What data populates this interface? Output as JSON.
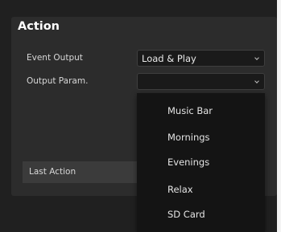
{
  "section": {
    "title": "Action"
  },
  "fields": {
    "event_output": {
      "label": "Event Output",
      "value": "Load & Play"
    },
    "output_param": {
      "label": "Output Param.",
      "value": ""
    }
  },
  "last_action": {
    "label": "Last Action"
  },
  "dropdown": {
    "options": [
      "Music Bar",
      "Mornings",
      "Evenings",
      "Relax",
      "SD Card"
    ]
  },
  "icons": {
    "select_arrow": "chevron-down-icon"
  }
}
